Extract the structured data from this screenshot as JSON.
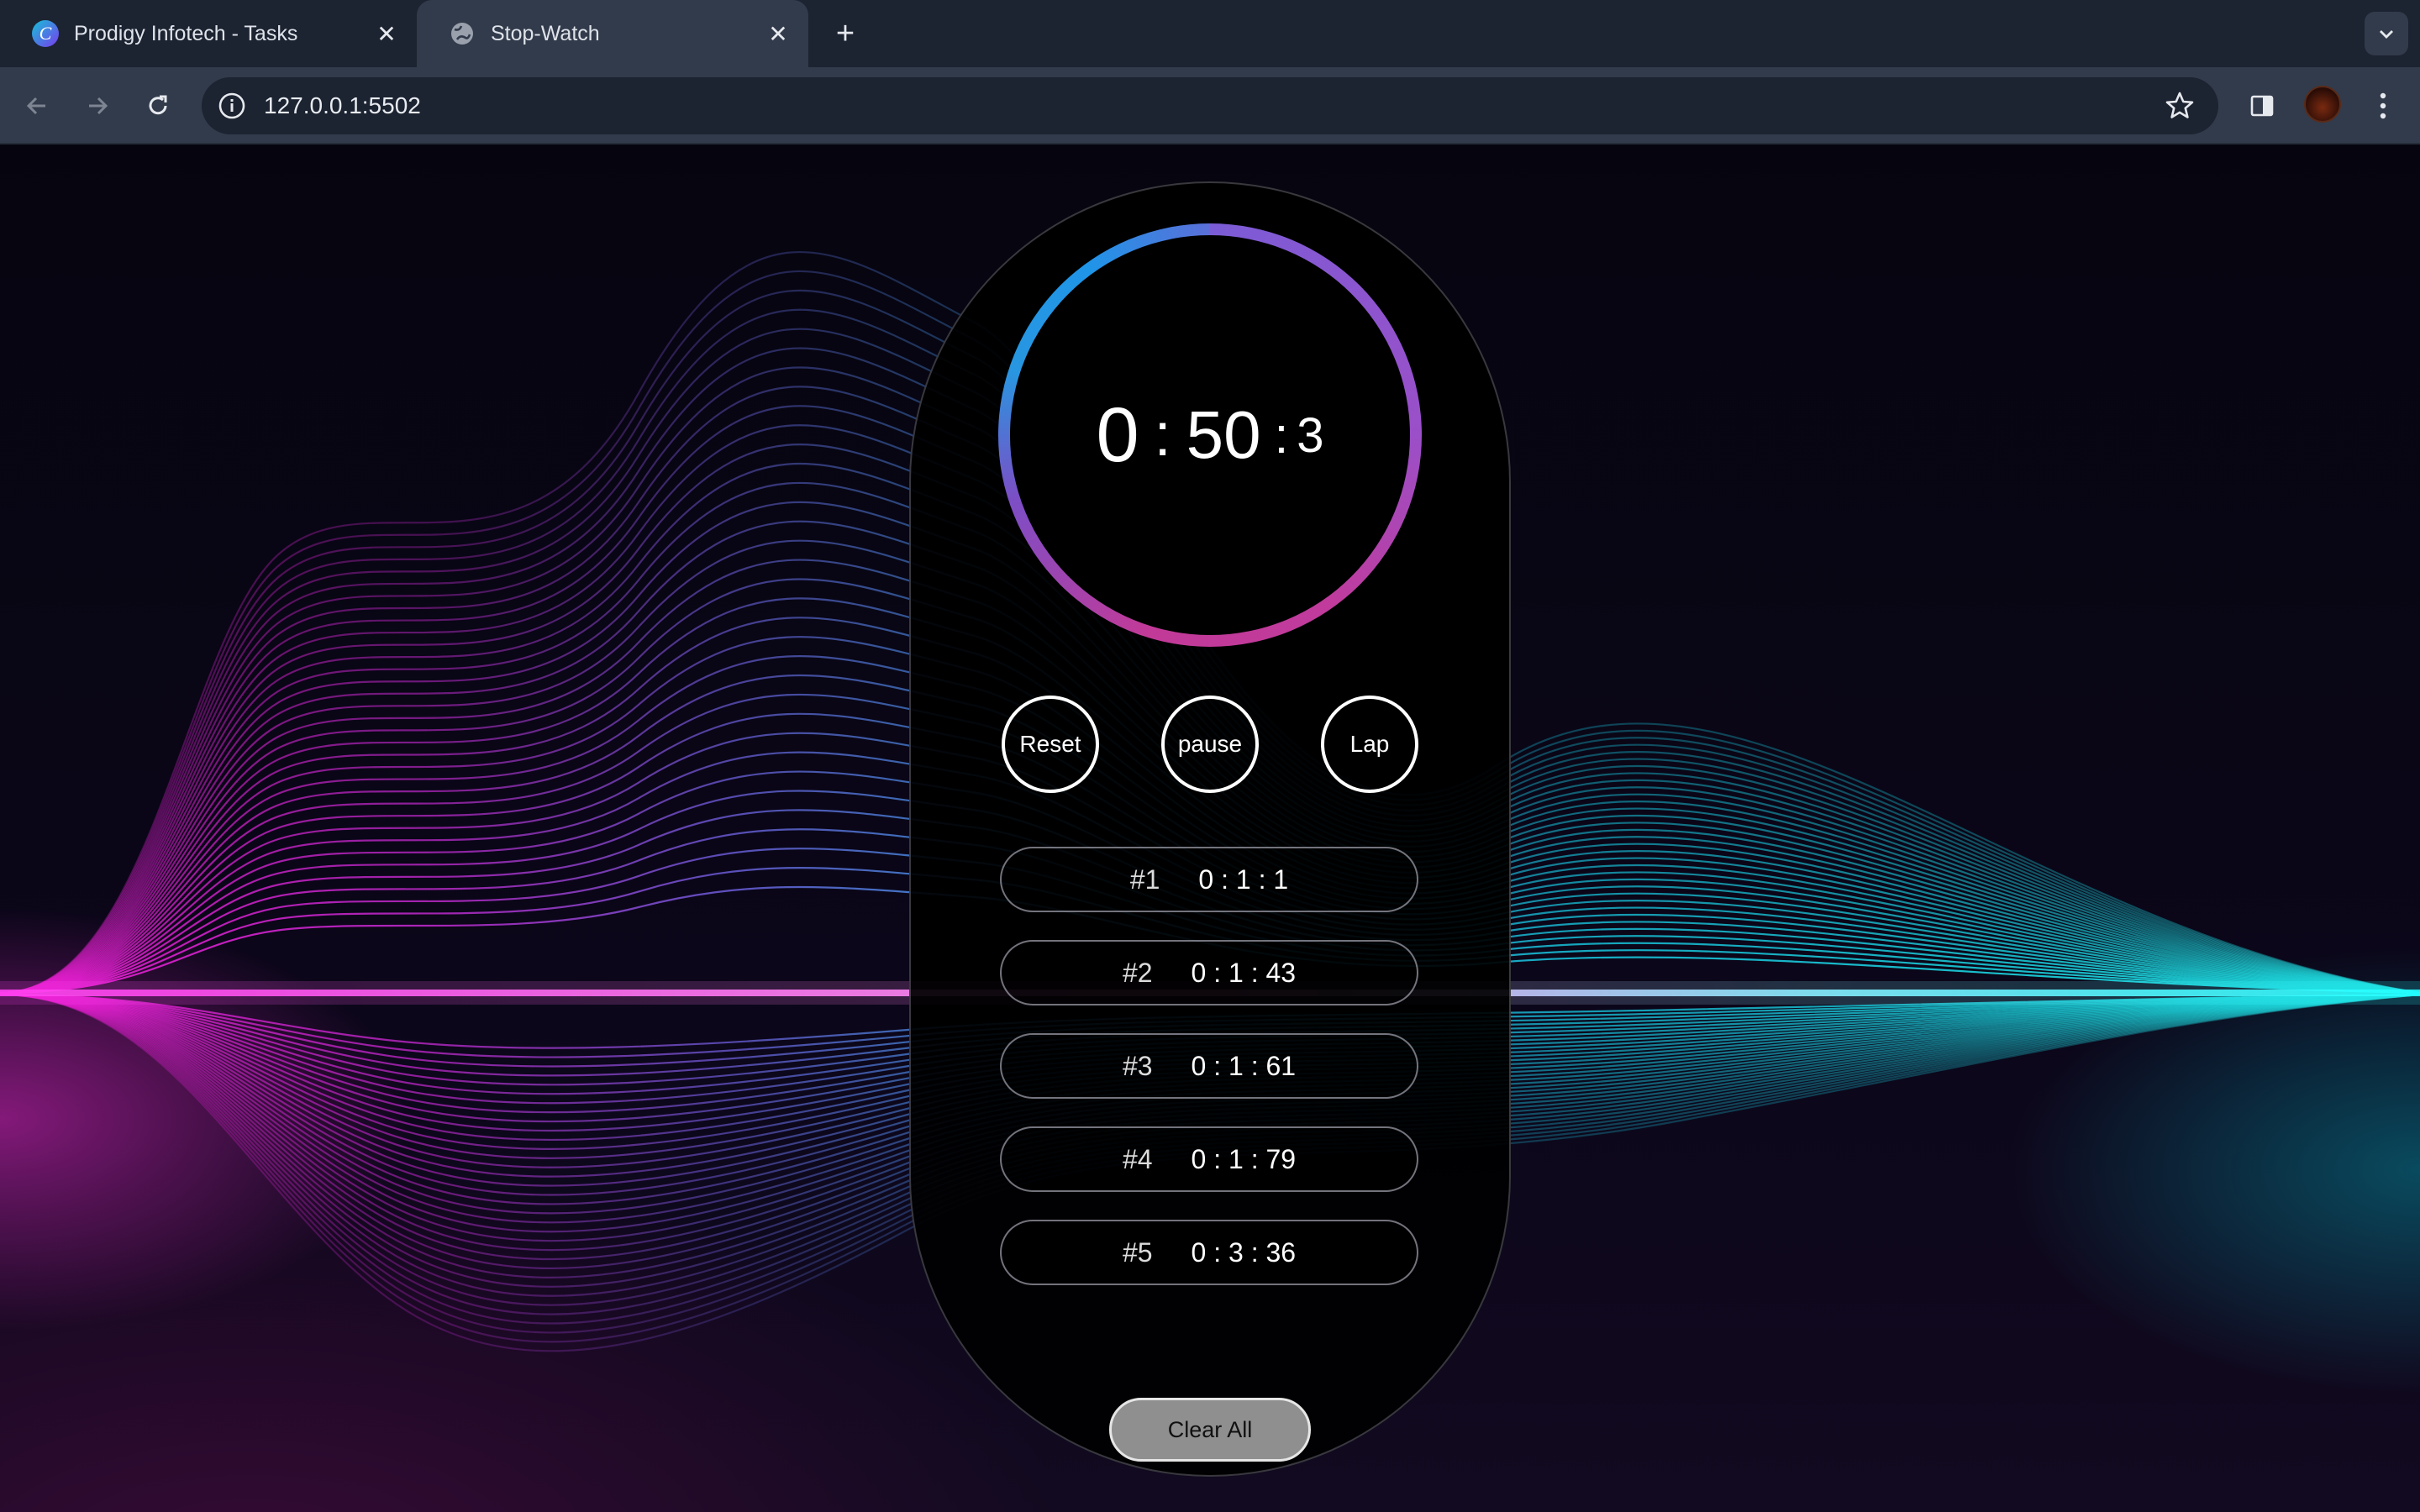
{
  "browser": {
    "tabs": [
      {
        "title": "Prodigy Infotech - Tasks",
        "icon": "canva-icon",
        "active": false
      },
      {
        "title": "Stop-Watch",
        "icon": "globe-icon",
        "active": true
      }
    ],
    "url": "127.0.0.1:5502"
  },
  "stopwatch": {
    "hours": "0",
    "separator": ":",
    "minutes": "50",
    "millis": "3",
    "buttons": {
      "reset": "Reset",
      "pause": "pause",
      "lap": "Lap"
    },
    "laps": [
      {
        "label": "#1",
        "time": "0 : 1 : 1"
      },
      {
        "label": "#2",
        "time": "0 : 1 : 43"
      },
      {
        "label": "#3",
        "time": "0 : 1 : 61"
      },
      {
        "label": "#4",
        "time": "0 : 1 : 79"
      },
      {
        "label": "#5",
        "time": "0 : 3 : 36"
      }
    ],
    "clear_label": "Clear All"
  },
  "colors": {
    "ring_blue": "#1f95e8",
    "ring_pink": "#c23a98",
    "wave_magenta": "#e628c8",
    "wave_cyan": "#00e0e8"
  }
}
